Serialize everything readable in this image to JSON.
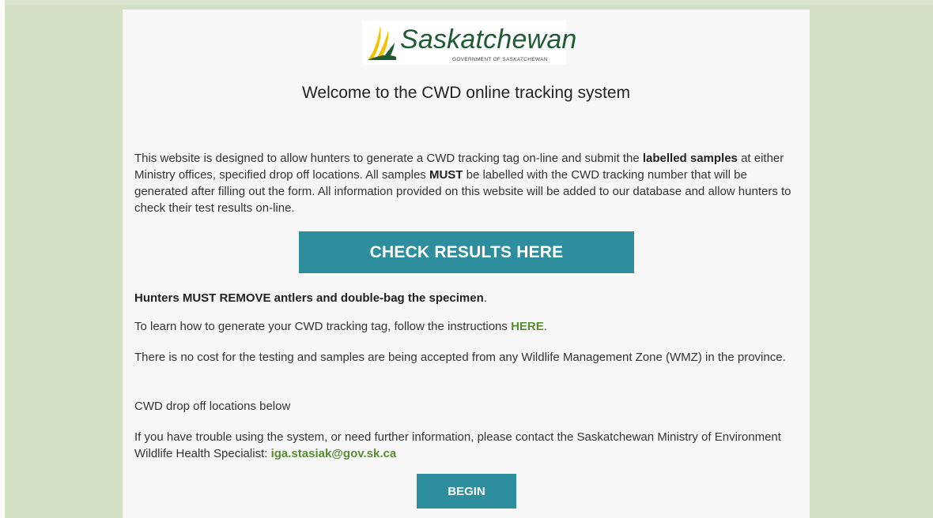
{
  "colors": {
    "page_background": "#d4e0c4",
    "card_background": "#f7f7f7",
    "button": "#2e8e9e",
    "link": "#5a8a32",
    "logo_green": "#1e5a32",
    "logo_yellow": "#f2c200"
  },
  "logo": {
    "icon": "wheat-icon",
    "word": "Saskatchewan",
    "subtitle": "GOVERNMENT OF SASKATCHEWAN"
  },
  "title": "Welcome to the CWD online tracking system",
  "intro": {
    "part1": "This website is designed to allow hunters to generate a CWD tracking tag on-line and submit the ",
    "bold1": "labelled samples",
    "part2": " at either Ministry offices, specified drop off locations. All samples ",
    "bold2": "MUST",
    "part3": " be labelled with the CWD tracking number that will be generated after filling out the form.  All information provided on this website will be added to our database and allow hunters to check their test results on-line."
  },
  "check_results_button": "CHECK RESULTS HERE",
  "hunters_notice": {
    "bold": "Hunters MUST REMOVE antlers and double-bag the specimen",
    "end": "."
  },
  "learn": {
    "text": "To learn how to generate your CWD tracking tag, follow the instructions ",
    "link": "HERE",
    "end": "."
  },
  "cost_text": "There is no cost for the testing and samples are being accepted from any Wildlife Management Zone (WMZ) in the province.",
  "dropoff_text": "CWD drop off locations below",
  "contact": {
    "text": "If you have trouble using the system, or need further information, please contact the Saskatchewan Ministry of Environment Wildlife Health Specialist: ",
    "email": "iga.stasiak@gov.sk.ca"
  },
  "begin_button": "BEGIN"
}
